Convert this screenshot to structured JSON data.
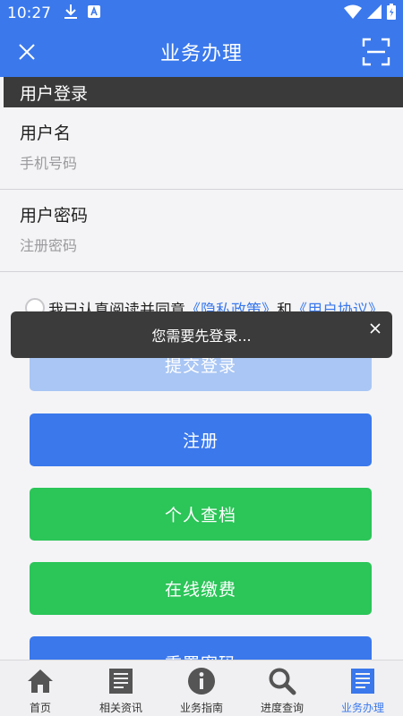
{
  "status_bar": {
    "time": "10:27"
  },
  "app_bar": {
    "title": "业务办理"
  },
  "section": {
    "title": "用户登录"
  },
  "form": {
    "username_label": "用户名",
    "username_placeholder": "手机号码",
    "username_value": "",
    "password_label": "用户密码",
    "password_placeholder": "注册密码",
    "password_value": ""
  },
  "agreement": {
    "prefix": "我已认真阅读并同意",
    "privacy_link": "《隐私政策》",
    "conjunction": "和",
    "user_link": "《用户协议》"
  },
  "buttons": {
    "submit": "提交登录",
    "register": "注册",
    "personal_file": "个人查档",
    "online_pay": "在线缴费",
    "reset_password": "重置密码"
  },
  "toast": {
    "message": "您需要先登录..."
  },
  "bottom_nav": {
    "items": [
      {
        "label": "首页",
        "icon": "home-icon"
      },
      {
        "label": "相关资讯",
        "icon": "news-icon"
      },
      {
        "label": "业务指南",
        "icon": "info-icon"
      },
      {
        "label": "进度查询",
        "icon": "search-icon"
      },
      {
        "label": "业务办理",
        "icon": "business-icon"
      }
    ],
    "active_index": 4
  },
  "colors": {
    "primary": "#3a78ec",
    "success": "#2bc558",
    "disabled": "#a9c6f4",
    "toast_bg": "#3b3b3b"
  }
}
